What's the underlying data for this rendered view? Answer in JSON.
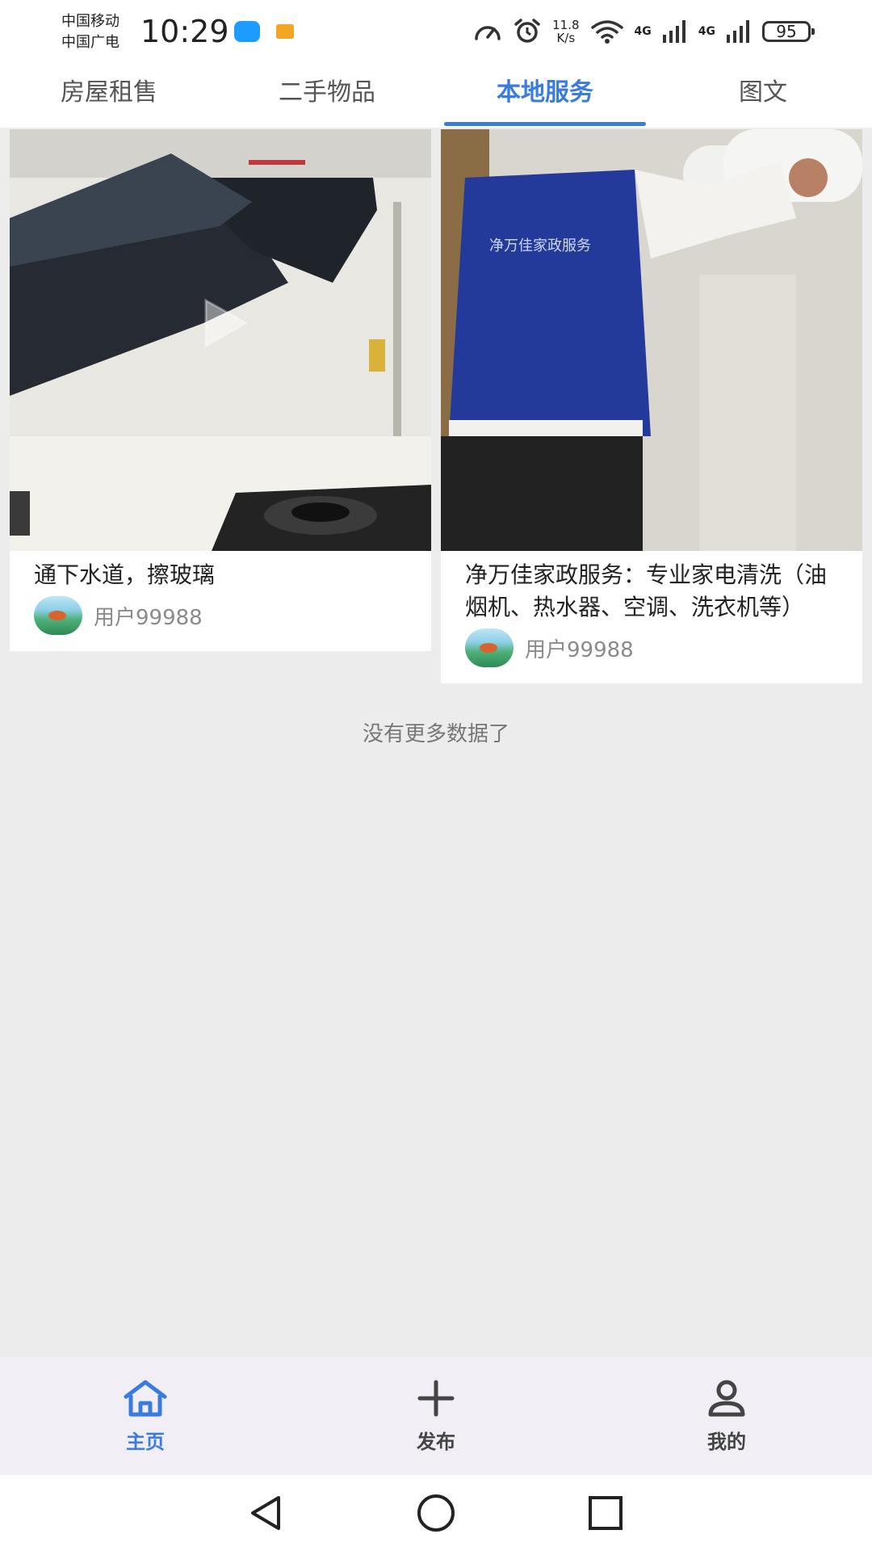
{
  "status_bar": {
    "carrier_1": "中国移动",
    "carrier_2": "中国广电",
    "time": "10:29",
    "speed_value": "11.8",
    "speed_unit": "K/s",
    "network_1": "4G",
    "network_2": "4G",
    "battery": "95"
  },
  "tabs": [
    {
      "label": "房屋租售",
      "active": false
    },
    {
      "label": "二手物品",
      "active": false
    },
    {
      "label": "本地服务",
      "active": true
    },
    {
      "label": "图文",
      "active": false
    }
  ],
  "cards": [
    {
      "title": "通下水道，擦玻璃",
      "author": "用户99988",
      "has_video": true
    },
    {
      "title": "净万佳家政服务：专业家电清洗（油烟机、热水器、空调、洗衣机等）",
      "author": "用户99988",
      "has_video": false
    }
  ],
  "end_text": "没有更多数据了",
  "bottom_nav": [
    {
      "label": "主页",
      "icon": "home-icon",
      "active": true
    },
    {
      "label": "发布",
      "icon": "plus-icon",
      "active": false
    },
    {
      "label": "我的",
      "icon": "user-icon",
      "active": false
    }
  ],
  "colors": {
    "accent": "#3a7be0",
    "background": "#ececec",
    "nav_background": "#f1eef5"
  }
}
